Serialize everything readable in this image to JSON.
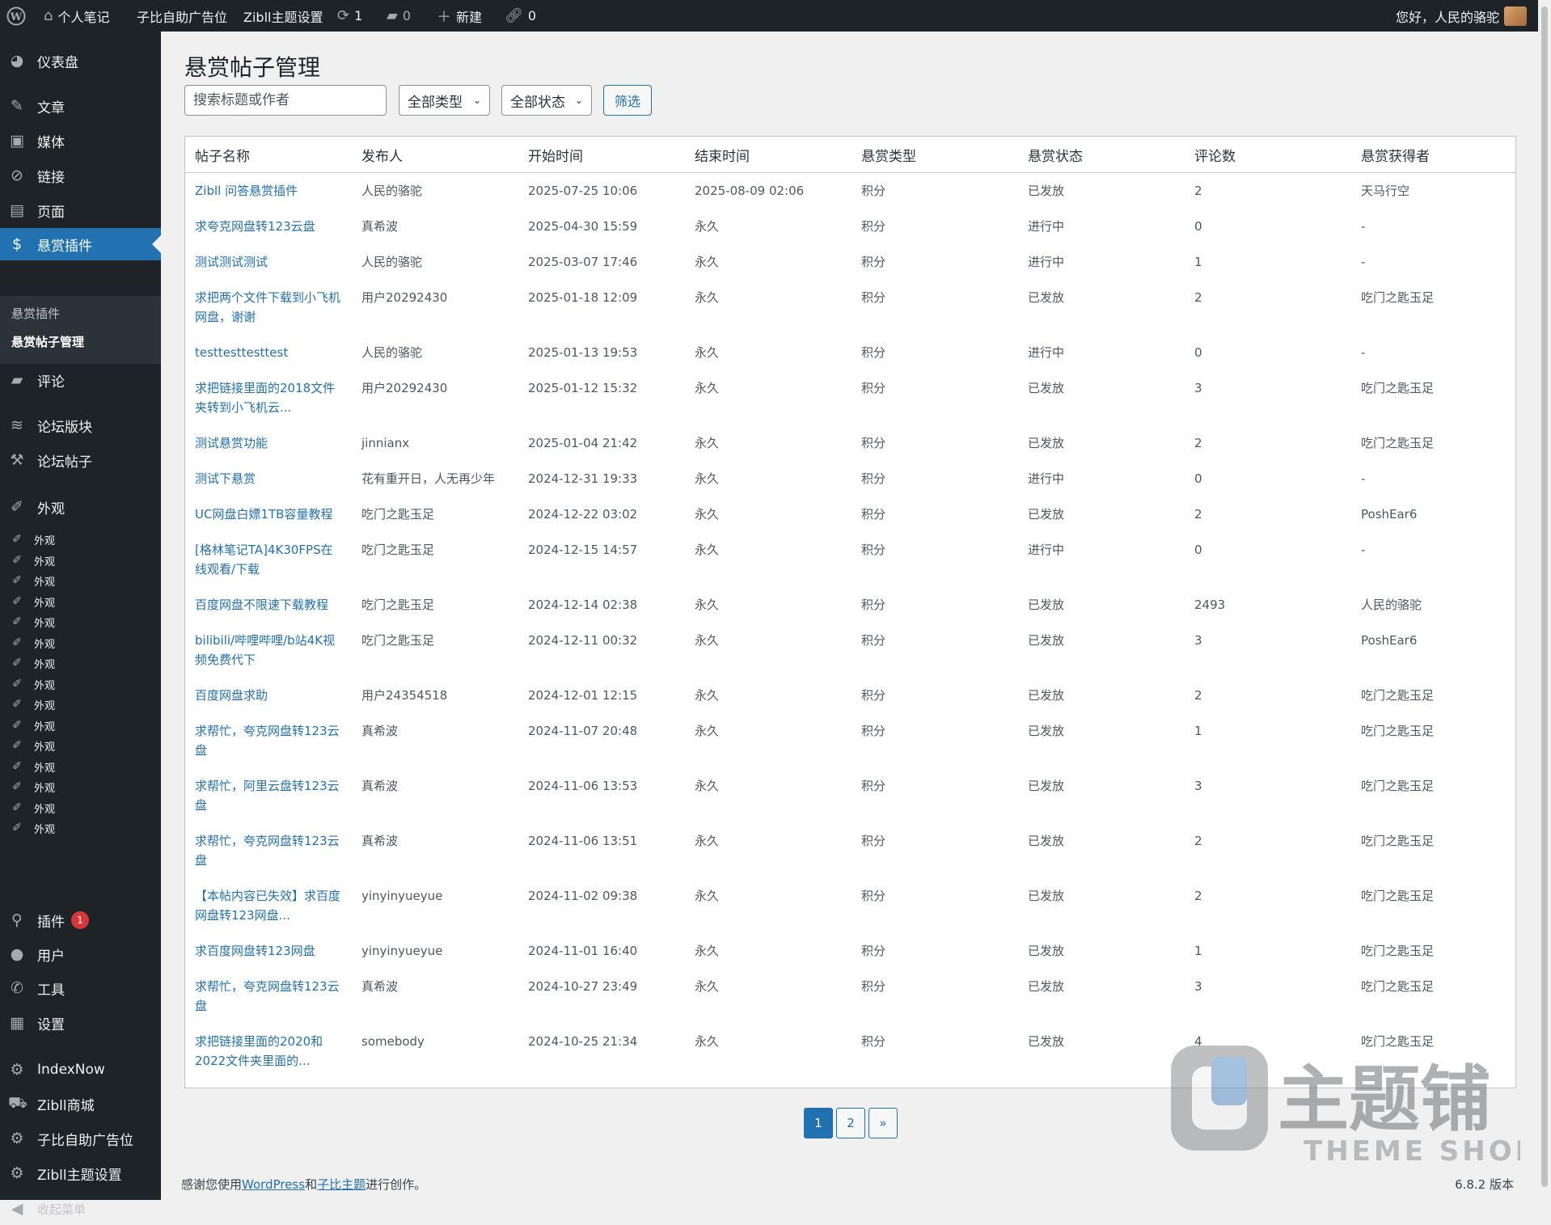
{
  "admin_bar": {
    "site_name": "个人笔记",
    "ad_label": "子比自助广告位",
    "theme_settings": "Zibll主题设置",
    "updates_count": "1",
    "comments_count": "0",
    "new_label": "新建",
    "links_count": "0",
    "greeting": "您好，人民的骆驼"
  },
  "sidebar": {
    "dashboard": "仪表盘",
    "posts": "文章",
    "media": "媒体",
    "links": "链接",
    "pages": "页面",
    "bounty_plugin": "悬赏插件",
    "submenu": {
      "item1": "悬赏插件",
      "item2": "悬赏帖子管理"
    },
    "comments": "评论",
    "forum_sections": "论坛版块",
    "forum_posts": "论坛帖子",
    "appearance": "外观",
    "appearance_repeat": [
      "外观",
      "外观",
      "外观",
      "外观",
      "外观",
      "外观",
      "外观",
      "外观",
      "外观",
      "外观",
      "外观",
      "外观",
      "外观",
      "外观",
      "外观"
    ],
    "plugins": "插件",
    "plugins_badge": "1",
    "users": "用户",
    "tools": "工具",
    "settings": "设置",
    "indexnow": "IndexNow",
    "zibll_shop": "Zibll商城",
    "ad_position": "子比自助广告位",
    "zibll_settings": "Zibll主题设置",
    "collapse": "收起菜单"
  },
  "main": {
    "title": "悬赏帖子管理",
    "search_placeholder": "搜索标题或作者",
    "type_select": "全部类型",
    "status_select": "全部状态",
    "filter_button": "筛选"
  },
  "table": {
    "headers": [
      "帖子名称",
      "发布人",
      "开始时间",
      "结束时间",
      "悬赏类型",
      "悬赏状态",
      "评论数",
      "悬赏获得者"
    ],
    "rows": [
      [
        "Zibll 问答悬赏插件",
        "人民的骆驼",
        "2025-07-25 10:06",
        "2025-08-09 02:06",
        "积分",
        "已发放",
        "2",
        "天马行空"
      ],
      [
        "求夸克网盘转123云盘",
        "真希波",
        "2025-04-30 15:59",
        "永久",
        "积分",
        "进行中",
        "0",
        "-"
      ],
      [
        "测试测试测试",
        "人民的骆驼",
        "2025-03-07 17:46",
        "永久",
        "积分",
        "进行中",
        "1",
        "-"
      ],
      [
        "求把两个文件下载到小飞机网盘，谢谢",
        "用户20292430",
        "2025-01-18 12:09",
        "永久",
        "积分",
        "已发放",
        "2",
        "吃门之匙玉足"
      ],
      [
        "testtesttesttest",
        "人民的骆驼",
        "2025-01-13 19:53",
        "永久",
        "积分",
        "进行中",
        "0",
        "-"
      ],
      [
        "求把链接里面的2018文件夹转到小飞机云...",
        "用户20292430",
        "2025-01-12 15:32",
        "永久",
        "积分",
        "已发放",
        "3",
        "吃门之匙玉足"
      ],
      [
        "测试悬赏功能",
        "jinnianx",
        "2025-01-04 21:42",
        "永久",
        "积分",
        "已发放",
        "2",
        "吃门之匙玉足"
      ],
      [
        "测试下悬赏",
        "花有重开日，人无再少年",
        "2024-12-31 19:33",
        "永久",
        "积分",
        "进行中",
        "0",
        "-"
      ],
      [
        "UC网盘白嫖1TB容量教程",
        "吃门之匙玉足",
        "2024-12-22 03:02",
        "永久",
        "积分",
        "已发放",
        "2",
        "PoshEar6"
      ],
      [
        "[格林笔记TA]4K30FPS在线观看/下载",
        "吃门之匙玉足",
        "2024-12-15 14:57",
        "永久",
        "积分",
        "进行中",
        "0",
        "-"
      ],
      [
        "百度网盘不限速下载教程",
        "吃门之匙玉足",
        "2024-12-14 02:38",
        "永久",
        "积分",
        "已发放",
        "2493",
        "人民的骆驼"
      ],
      [
        "bilibili/哔哩哔哩/b站4K视频免费代下",
        "吃门之匙玉足",
        "2024-12-11 00:32",
        "永久",
        "积分",
        "已发放",
        "3",
        "PoshEar6"
      ],
      [
        "百度网盘求助",
        "用户24354518",
        "2024-12-01 12:15",
        "永久",
        "积分",
        "已发放",
        "2",
        "吃门之匙玉足"
      ],
      [
        "求帮忙，夸克网盘转123云盘",
        "真希波",
        "2024-11-07 20:48",
        "永久",
        "积分",
        "已发放",
        "1",
        "吃门之匙玉足"
      ],
      [
        "求帮忙，阿里云盘转123云盘",
        "真希波",
        "2024-11-06 13:53",
        "永久",
        "积分",
        "已发放",
        "3",
        "吃门之匙玉足"
      ],
      [
        "求帮忙，夸克网盘转123云盘",
        "真希波",
        "2024-11-06 13:51",
        "永久",
        "积分",
        "已发放",
        "2",
        "吃门之匙玉足"
      ],
      [
        "【本帖内容已失效】求百度网盘转123网盘...",
        "yinyinyueyue",
        "2024-11-02 09:38",
        "永久",
        "积分",
        "已发放",
        "2",
        "吃门之匙玉足"
      ],
      [
        "求百度网盘转123网盘",
        "yinyinyueyue",
        "2024-11-01 16:40",
        "永久",
        "积分",
        "已发放",
        "1",
        "吃门之匙玉足"
      ],
      [
        "求帮忙，夸克网盘转123云盘",
        "真希波",
        "2024-10-27 23:49",
        "永久",
        "积分",
        "已发放",
        "3",
        "吃门之匙玉足"
      ],
      [
        "求把链接里面的2020和2022文件夹里面的...",
        "somebody",
        "2024-10-25 21:34",
        "永久",
        "积分",
        "已发放",
        "4",
        "吃门之匙玉足"
      ]
    ]
  },
  "pagination": {
    "page1": "1",
    "page2": "2",
    "next": "»"
  },
  "footer": {
    "thanks_prefix": "感谢您使用",
    "wordpress": "WordPress",
    "and": "和",
    "theme": "子比主题",
    "suffix": "进行创作。",
    "version": "6.8.2 版本"
  },
  "watermark": {
    "brand": "主题铺",
    "sub": "THEME SHOP"
  },
  "colors": {
    "accent": "#2271b1",
    "sidebar_bg": "#1d2327",
    "badge": "#d63638"
  }
}
